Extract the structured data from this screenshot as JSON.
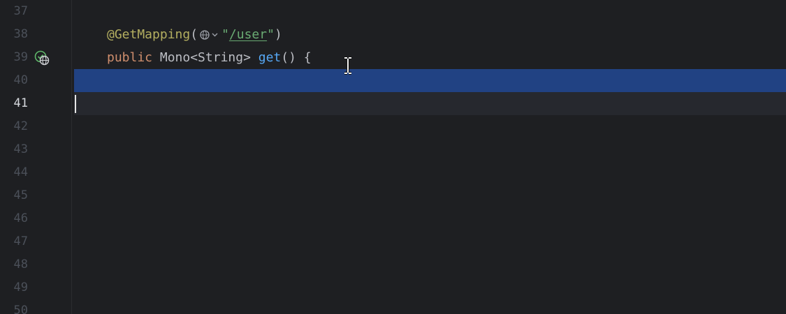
{
  "editor": {
    "lines": [
      {
        "number": "37"
      },
      {
        "number": "38"
      },
      {
        "number": "39"
      },
      {
        "number": "40"
      },
      {
        "number": "41"
      },
      {
        "number": "42"
      },
      {
        "number": "43"
      },
      {
        "number": "44"
      },
      {
        "number": "45"
      },
      {
        "number": "46"
      },
      {
        "number": "47"
      },
      {
        "number": "48"
      },
      {
        "number": "49"
      },
      {
        "number": "50"
      }
    ],
    "current_line": "41",
    "selected_line": "40",
    "code": {
      "line38": {
        "annotation": "@GetMapping",
        "open_paren": "(",
        "quote_open": "\"",
        "url": "/user",
        "quote_close": "\"",
        "close_paren": ")"
      },
      "line39": {
        "modifier": "public",
        "return_type": " Mono<String> ",
        "method": "get",
        "signature_rest": "() {"
      }
    },
    "icons": {
      "gutter_line39": "web-endpoint-icon",
      "inlay_line38": "globe-dropdown-icon",
      "cursor": "ibeam-cursor-icon"
    },
    "colors": {
      "background": "#1e1f22",
      "selection": "#214283",
      "current_line": "#26282e",
      "annotation": "#b3ae60",
      "keyword": "#cf8e6d",
      "method": "#56a8f5",
      "string": "#6aab73"
    }
  }
}
